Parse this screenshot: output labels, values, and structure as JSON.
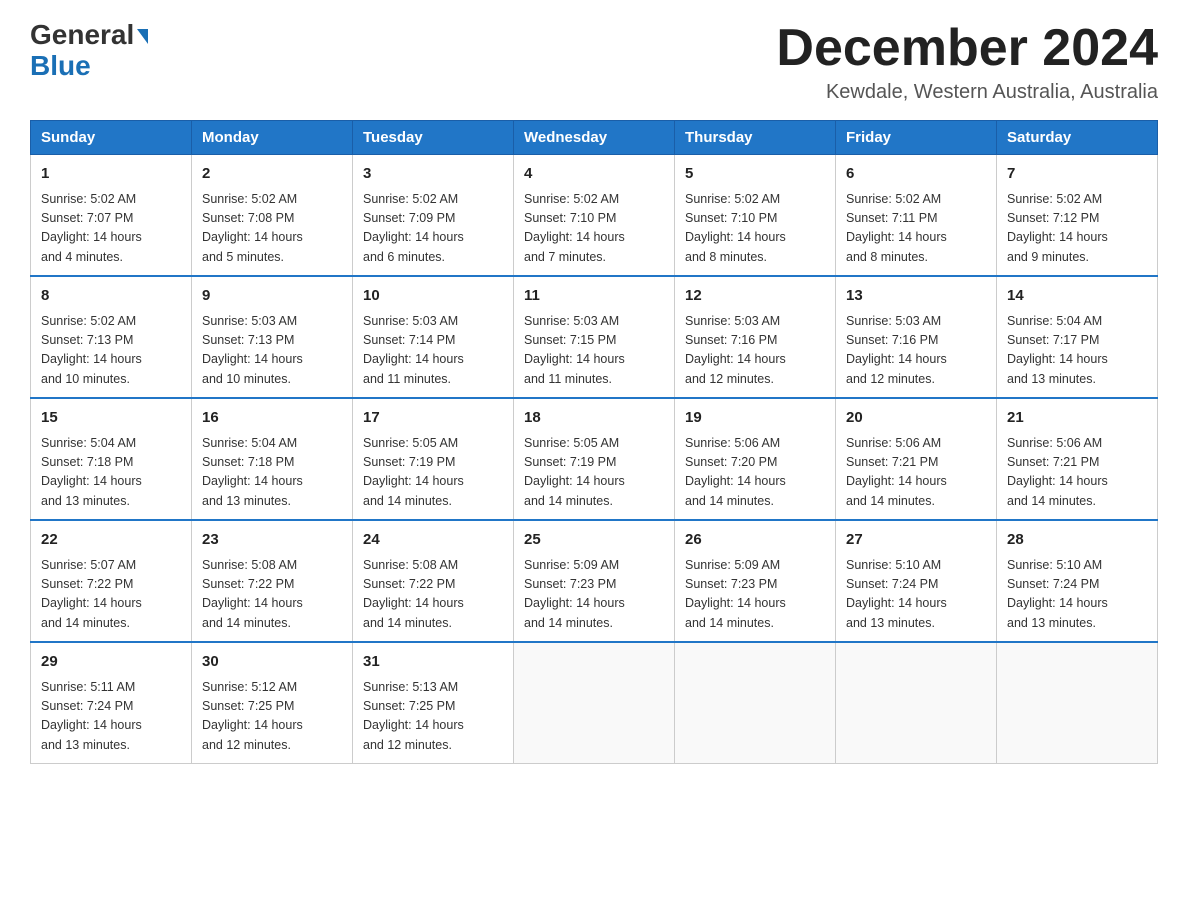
{
  "header": {
    "logo_line1": "General",
    "logo_line2": "Blue",
    "month_title": "December 2024",
    "location": "Kewdale, Western Australia, Australia"
  },
  "days_of_week": [
    "Sunday",
    "Monday",
    "Tuesday",
    "Wednesday",
    "Thursday",
    "Friday",
    "Saturday"
  ],
  "weeks": [
    [
      {
        "day": "1",
        "sunrise": "5:02 AM",
        "sunset": "7:07 PM",
        "daylight": "14 hours and 4 minutes."
      },
      {
        "day": "2",
        "sunrise": "5:02 AM",
        "sunset": "7:08 PM",
        "daylight": "14 hours and 5 minutes."
      },
      {
        "day": "3",
        "sunrise": "5:02 AM",
        "sunset": "7:09 PM",
        "daylight": "14 hours and 6 minutes."
      },
      {
        "day": "4",
        "sunrise": "5:02 AM",
        "sunset": "7:10 PM",
        "daylight": "14 hours and 7 minutes."
      },
      {
        "day": "5",
        "sunrise": "5:02 AM",
        "sunset": "7:10 PM",
        "daylight": "14 hours and 8 minutes."
      },
      {
        "day": "6",
        "sunrise": "5:02 AM",
        "sunset": "7:11 PM",
        "daylight": "14 hours and 8 minutes."
      },
      {
        "day": "7",
        "sunrise": "5:02 AM",
        "sunset": "7:12 PM",
        "daylight": "14 hours and 9 minutes."
      }
    ],
    [
      {
        "day": "8",
        "sunrise": "5:02 AM",
        "sunset": "7:13 PM",
        "daylight": "14 hours and 10 minutes."
      },
      {
        "day": "9",
        "sunrise": "5:03 AM",
        "sunset": "7:13 PM",
        "daylight": "14 hours and 10 minutes."
      },
      {
        "day": "10",
        "sunrise": "5:03 AM",
        "sunset": "7:14 PM",
        "daylight": "14 hours and 11 minutes."
      },
      {
        "day": "11",
        "sunrise": "5:03 AM",
        "sunset": "7:15 PM",
        "daylight": "14 hours and 11 minutes."
      },
      {
        "day": "12",
        "sunrise": "5:03 AM",
        "sunset": "7:16 PM",
        "daylight": "14 hours and 12 minutes."
      },
      {
        "day": "13",
        "sunrise": "5:03 AM",
        "sunset": "7:16 PM",
        "daylight": "14 hours and 12 minutes."
      },
      {
        "day": "14",
        "sunrise": "5:04 AM",
        "sunset": "7:17 PM",
        "daylight": "14 hours and 13 minutes."
      }
    ],
    [
      {
        "day": "15",
        "sunrise": "5:04 AM",
        "sunset": "7:18 PM",
        "daylight": "14 hours and 13 minutes."
      },
      {
        "day": "16",
        "sunrise": "5:04 AM",
        "sunset": "7:18 PM",
        "daylight": "14 hours and 13 minutes."
      },
      {
        "day": "17",
        "sunrise": "5:05 AM",
        "sunset": "7:19 PM",
        "daylight": "14 hours and 14 minutes."
      },
      {
        "day": "18",
        "sunrise": "5:05 AM",
        "sunset": "7:19 PM",
        "daylight": "14 hours and 14 minutes."
      },
      {
        "day": "19",
        "sunrise": "5:06 AM",
        "sunset": "7:20 PM",
        "daylight": "14 hours and 14 minutes."
      },
      {
        "day": "20",
        "sunrise": "5:06 AM",
        "sunset": "7:21 PM",
        "daylight": "14 hours and 14 minutes."
      },
      {
        "day": "21",
        "sunrise": "5:06 AM",
        "sunset": "7:21 PM",
        "daylight": "14 hours and 14 minutes."
      }
    ],
    [
      {
        "day": "22",
        "sunrise": "5:07 AM",
        "sunset": "7:22 PM",
        "daylight": "14 hours and 14 minutes."
      },
      {
        "day": "23",
        "sunrise": "5:08 AM",
        "sunset": "7:22 PM",
        "daylight": "14 hours and 14 minutes."
      },
      {
        "day": "24",
        "sunrise": "5:08 AM",
        "sunset": "7:22 PM",
        "daylight": "14 hours and 14 minutes."
      },
      {
        "day": "25",
        "sunrise": "5:09 AM",
        "sunset": "7:23 PM",
        "daylight": "14 hours and 14 minutes."
      },
      {
        "day": "26",
        "sunrise": "5:09 AM",
        "sunset": "7:23 PM",
        "daylight": "14 hours and 14 minutes."
      },
      {
        "day": "27",
        "sunrise": "5:10 AM",
        "sunset": "7:24 PM",
        "daylight": "14 hours and 13 minutes."
      },
      {
        "day": "28",
        "sunrise": "5:10 AM",
        "sunset": "7:24 PM",
        "daylight": "14 hours and 13 minutes."
      }
    ],
    [
      {
        "day": "29",
        "sunrise": "5:11 AM",
        "sunset": "7:24 PM",
        "daylight": "14 hours and 13 minutes."
      },
      {
        "day": "30",
        "sunrise": "5:12 AM",
        "sunset": "7:25 PM",
        "daylight": "14 hours and 12 minutes."
      },
      {
        "day": "31",
        "sunrise": "5:13 AM",
        "sunset": "7:25 PM",
        "daylight": "14 hours and 12 minutes."
      },
      null,
      null,
      null,
      null
    ]
  ],
  "labels": {
    "sunrise": "Sunrise:",
    "sunset": "Sunset:",
    "daylight": "Daylight:"
  }
}
